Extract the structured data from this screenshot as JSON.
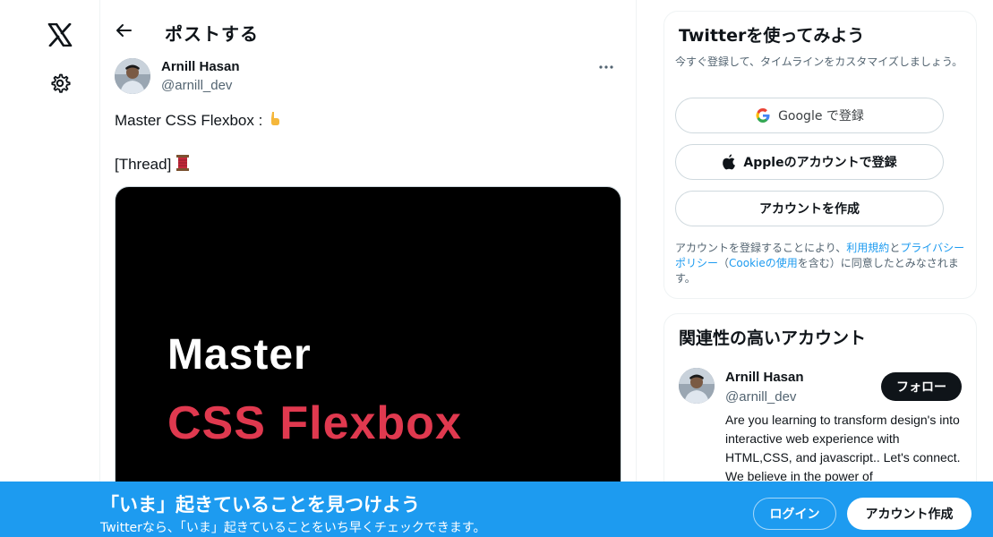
{
  "nav": {
    "logo_icon": "x-logo-icon",
    "settings_icon": "gear-icon"
  },
  "header": {
    "back_icon": "arrow-left-icon",
    "title": "ポストする"
  },
  "tweet": {
    "author_name": "Arnill Hasan",
    "author_handle": "@arnill_dev",
    "text_line1": "Master CSS Flexbox :",
    "text_line1_emoji": "👇",
    "text_line2": "[Thread]",
    "text_line2_emoji": "🧵",
    "media": {
      "line1": "Master",
      "line2": "CSS Flexbox"
    }
  },
  "signup_card": {
    "title": "Twitterを使ってみよう",
    "subtitle": "今すぐ登録して、タイムラインをカスタマイズしましょう。",
    "google_label": "Google で登録",
    "apple_label": "Appleのアカウントで登録",
    "create_label": "アカウントを作成",
    "terms_pre": "アカウントを登録することにより、",
    "terms_link1": "利用規約",
    "terms_mid1": "と",
    "terms_link2": "プライバシーポリシー",
    "terms_mid2": "（",
    "terms_link3": "Cookieの使用",
    "terms_post": "を含む）に同意したとみなされます。"
  },
  "related": {
    "title": "関連性の高いアカウント",
    "name": "Arnill Hasan",
    "handle": "@arnill_dev",
    "follow_label": "フォロー",
    "bio": "Are you learning to transform design's into interactive web experience with HTML,CSS, and javascript.. Let's connect. We believe in the power of"
  },
  "banner": {
    "title": "「いま」起きていることを見つけよう",
    "subtitle": "Twitterなら、「いま」起きていることをいち早くチェックできます。",
    "login_label": "ログイン",
    "signup_label": "アカウント作成"
  },
  "colors": {
    "accent": "#1d9bf0",
    "media_highlight": "#e0394f",
    "text": "#0f1419",
    "muted": "#536471"
  }
}
